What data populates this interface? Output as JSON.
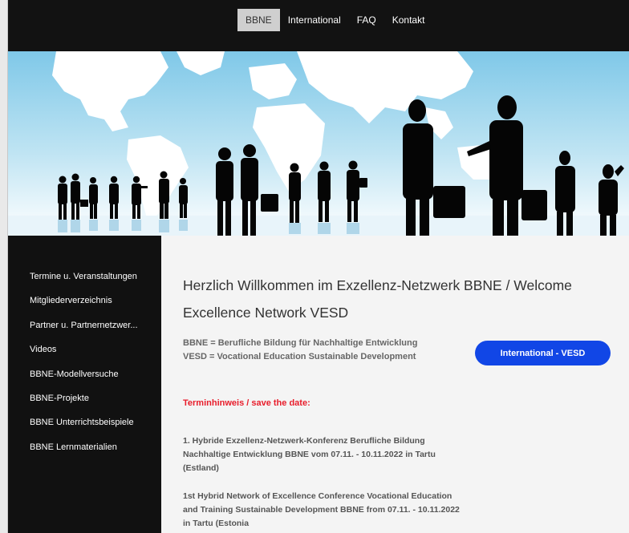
{
  "nav": {
    "items": [
      {
        "label": "BBNE",
        "active": true
      },
      {
        "label": "International",
        "active": false
      },
      {
        "label": "FAQ",
        "active": false
      },
      {
        "label": "Kontakt",
        "active": false
      }
    ]
  },
  "sidebar": {
    "items": [
      {
        "label": "Termine u. Veranstaltungen"
      },
      {
        "label": "Mitgliederverzeichnis"
      },
      {
        "label": "Partner u. Partnernetzwer..."
      },
      {
        "label": "Videos"
      },
      {
        "label": "BBNE-Modellversuche"
      },
      {
        "label": "BBNE-Projekte"
      },
      {
        "label": "BBNE Unterrichtsbeispiele"
      },
      {
        "label": "BBNE Lernmaterialien"
      }
    ]
  },
  "main": {
    "title": "Herzlich Willkommen im Exzellenz-Netzwerk BBNE / Welcome Excellence Network VESD",
    "definition_1": "BBNE =  Berufliche Bildung für Nachhaltige Entwicklung",
    "definition_2": "VESD = Vocational Education Sustainable Development",
    "cta_label": "International - VESD",
    "notice": "Terminhinweis / save the date:",
    "paragraph_1": "1. Hybride Exzellenz-Netzwerk-Konferenz Berufliche Bildung Nachhaltige Entwicklung BBNE vom 07.11. - 10.11.2022 in Tartu (Estland)",
    "paragraph_2": "1st Hybrid Network of Excellence Conference Vocational Education and Training Sustainable Development BBNE from 07.11. - 10.11.2022 in Tartu (Estonia"
  },
  "colors": {
    "topbar": "#121212",
    "sidebar": "#111111",
    "accent_button": "#1146e6",
    "notice": "#e81d2b",
    "hero_sky_top": "#7fc8e8",
    "hero_sky_bottom": "#ffffff"
  }
}
